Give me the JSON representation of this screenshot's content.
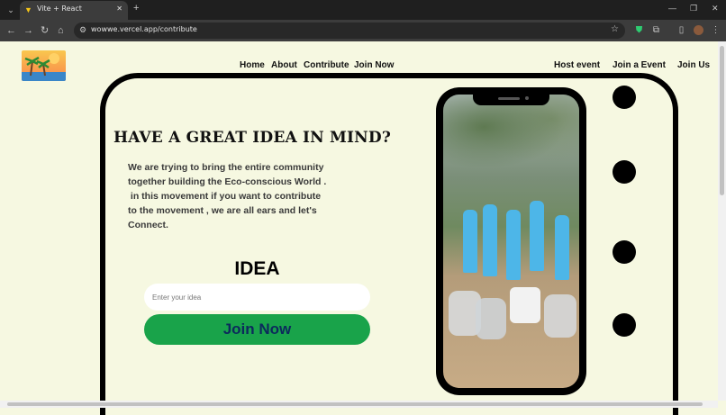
{
  "browser": {
    "tab_title": "Vite + React",
    "url": "wowwe.vercel.app/contribute"
  },
  "nav_left": [
    "Home",
    "About",
    "Contribute",
    "Join Now"
  ],
  "nav_right": [
    "Host event",
    "Join a Event",
    "Join Us"
  ],
  "hero": {
    "headline": "HAVE A GREAT IDEA IN MIND?",
    "description_lines": [
      "We are trying to bring the entire community",
      "together building the Eco-conscious World .",
      " in this movement if you want to contribute",
      "to the movement , we are all ears and let's",
      "Connect."
    ]
  },
  "idea_form": {
    "title": "IDEA",
    "input_placeholder": "Enter your idea",
    "input_value": "",
    "submit_label": "Join Now"
  },
  "colors": {
    "page_background": "#f6f8e1",
    "button_green": "#19a34a",
    "button_text": "#0c2a5c"
  }
}
